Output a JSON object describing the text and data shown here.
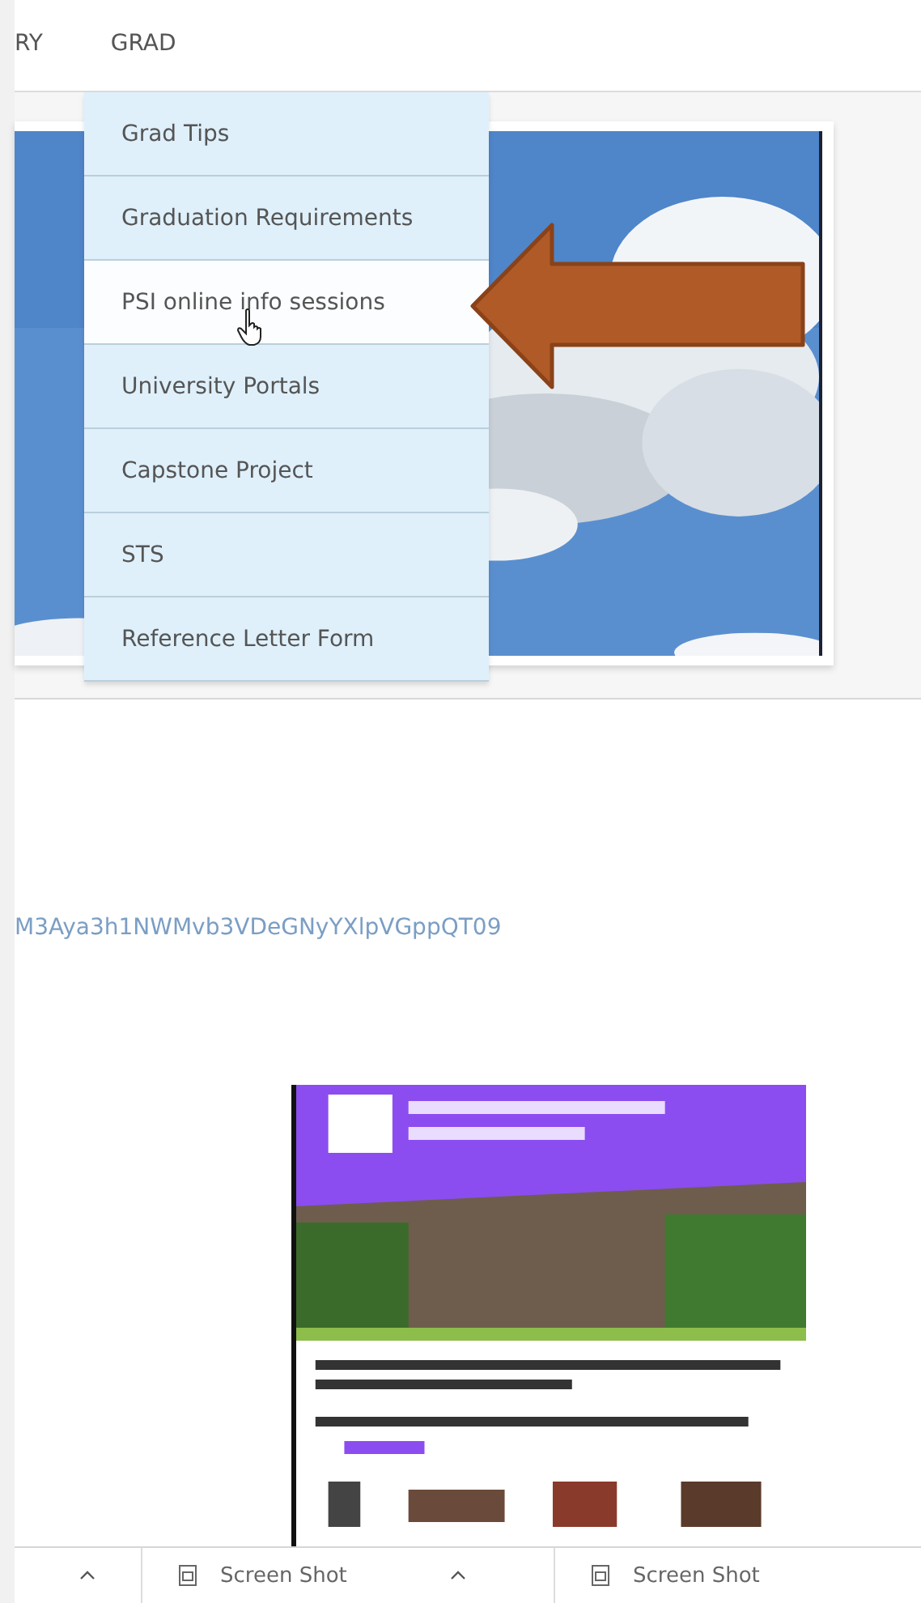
{
  "nav": [
    {
      "label": "RY"
    },
    {
      "label": "GRAD"
    }
  ],
  "grad_menu": {
    "items": [
      {
        "label": "Grad Tips",
        "selected": false
      },
      {
        "label": "Graduation Requirements",
        "selected": false
      },
      {
        "label": "PSI online info sessions",
        "selected": true
      },
      {
        "label": "University Portals",
        "selected": false
      },
      {
        "label": "Capstone Project",
        "selected": false
      },
      {
        "label": "STS",
        "selected": false
      },
      {
        "label": "Reference Letter Form",
        "selected": false
      }
    ]
  },
  "link_text": "M3Aya3h1NWMvb3VDeGNyYXlpVGppQT09",
  "attachments": [
    {
      "label": "Screen Shot"
    },
    {
      "label": "Screen Shot"
    }
  ]
}
